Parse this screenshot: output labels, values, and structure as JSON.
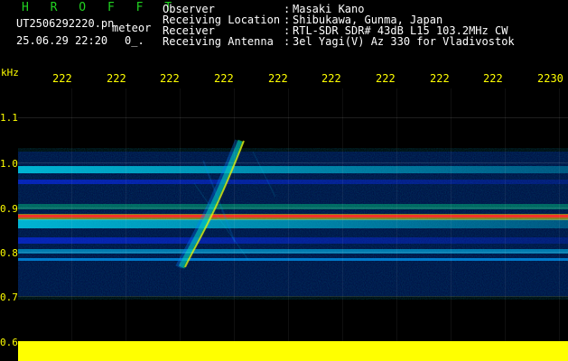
{
  "header": {
    "title": "H R O F F T",
    "filename": "UT2506292220.pn",
    "type": "meteor",
    "datetime": "25.06.29 22:20",
    "suffix": "0_."
  },
  "meta": [
    {
      "label": "Observer",
      "value": "Masaki Kano"
    },
    {
      "label": "Receiving Location",
      "value": "Shibukawa, Gunma, Japan"
    },
    {
      "label": "Receiver",
      "value": "RTL-SDR SDR# 43dB L15 103.2MHz CW"
    },
    {
      "label": "Receiving Antenna",
      "value": "3el Yagi(V) Az 330 for Vladivostok"
    }
  ],
  "xaxis": {
    "unit": "kHz",
    "ticks": [
      "222",
      "222",
      "222",
      "222",
      "222",
      "222",
      "222",
      "222",
      "222",
      "2230"
    ]
  },
  "yaxis": {
    "ticks": [
      "1.1",
      "1.0",
      "0.9",
      "0.8",
      "0.7",
      "0.6"
    ]
  },
  "colors": {
    "background": "#000000",
    "text": "#ffffff",
    "axis": "#ffff00",
    "accent_green": "#21d321",
    "signal_red": "#ff2a2a",
    "signal_yellow": "#ffff00",
    "signal_cyan": "#00f0ff",
    "signal_blue": "#0040ff"
  }
}
